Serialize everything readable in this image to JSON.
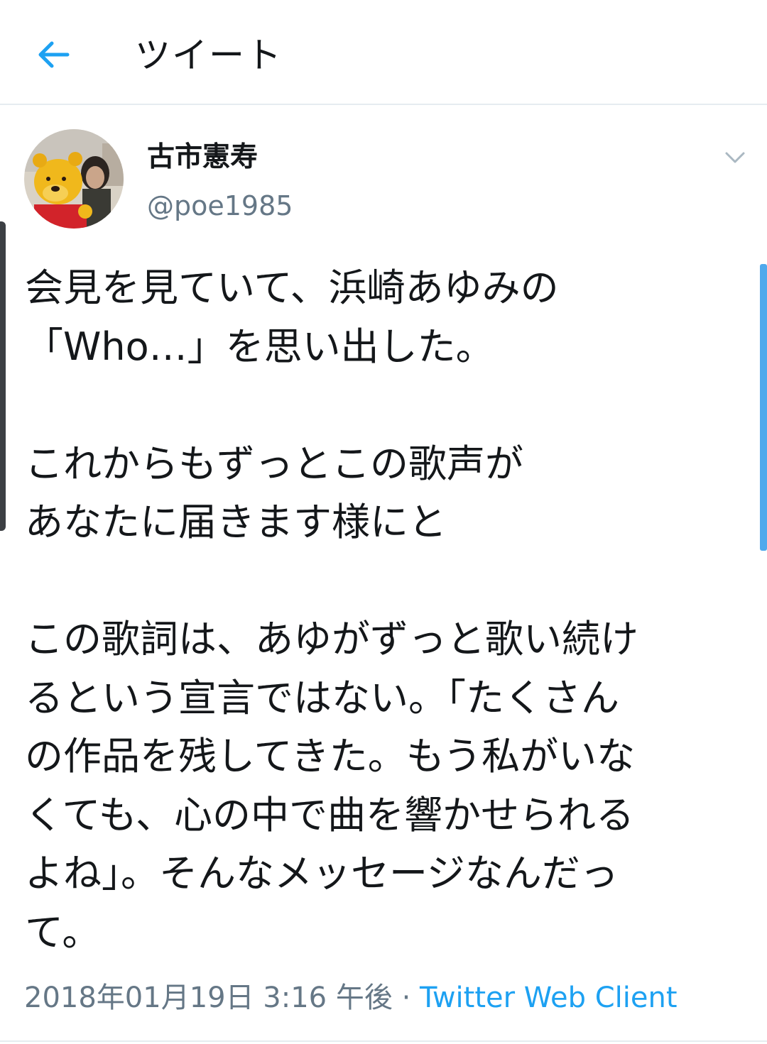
{
  "header": {
    "back_icon": "arrow-left-icon",
    "title": "ツイート"
  },
  "tweet": {
    "avatar_icon": "avatar-image",
    "display_name": "古市憲寿",
    "handle": "@poe1985",
    "menu_icon": "chevron-down-icon",
    "text_lines": [
      "会見を見ていて、浜崎あゆみの",
      "「Who…」を思い出した。",
      "",
      "これからもずっとこの歌声が",
      "あなたに届きます様にと",
      "",
      "この歌詞は、あゆがずっと歌い続け",
      "るという宣言ではない。「たくさん",
      "の作品を残してきた。もう私がいな",
      "くても、心の中で曲を響かせられる",
      "よね」。そんなメッセージなんだっ",
      "て。"
    ],
    "timestamp": "2018年01月19日 3:16 午後",
    "separator": " · ",
    "client": "Twitter Web Client"
  },
  "colors": {
    "accent": "#1da1f2",
    "secondary_text": "#657786",
    "primary_text": "#14171a",
    "divider": "#e6ecf0"
  }
}
